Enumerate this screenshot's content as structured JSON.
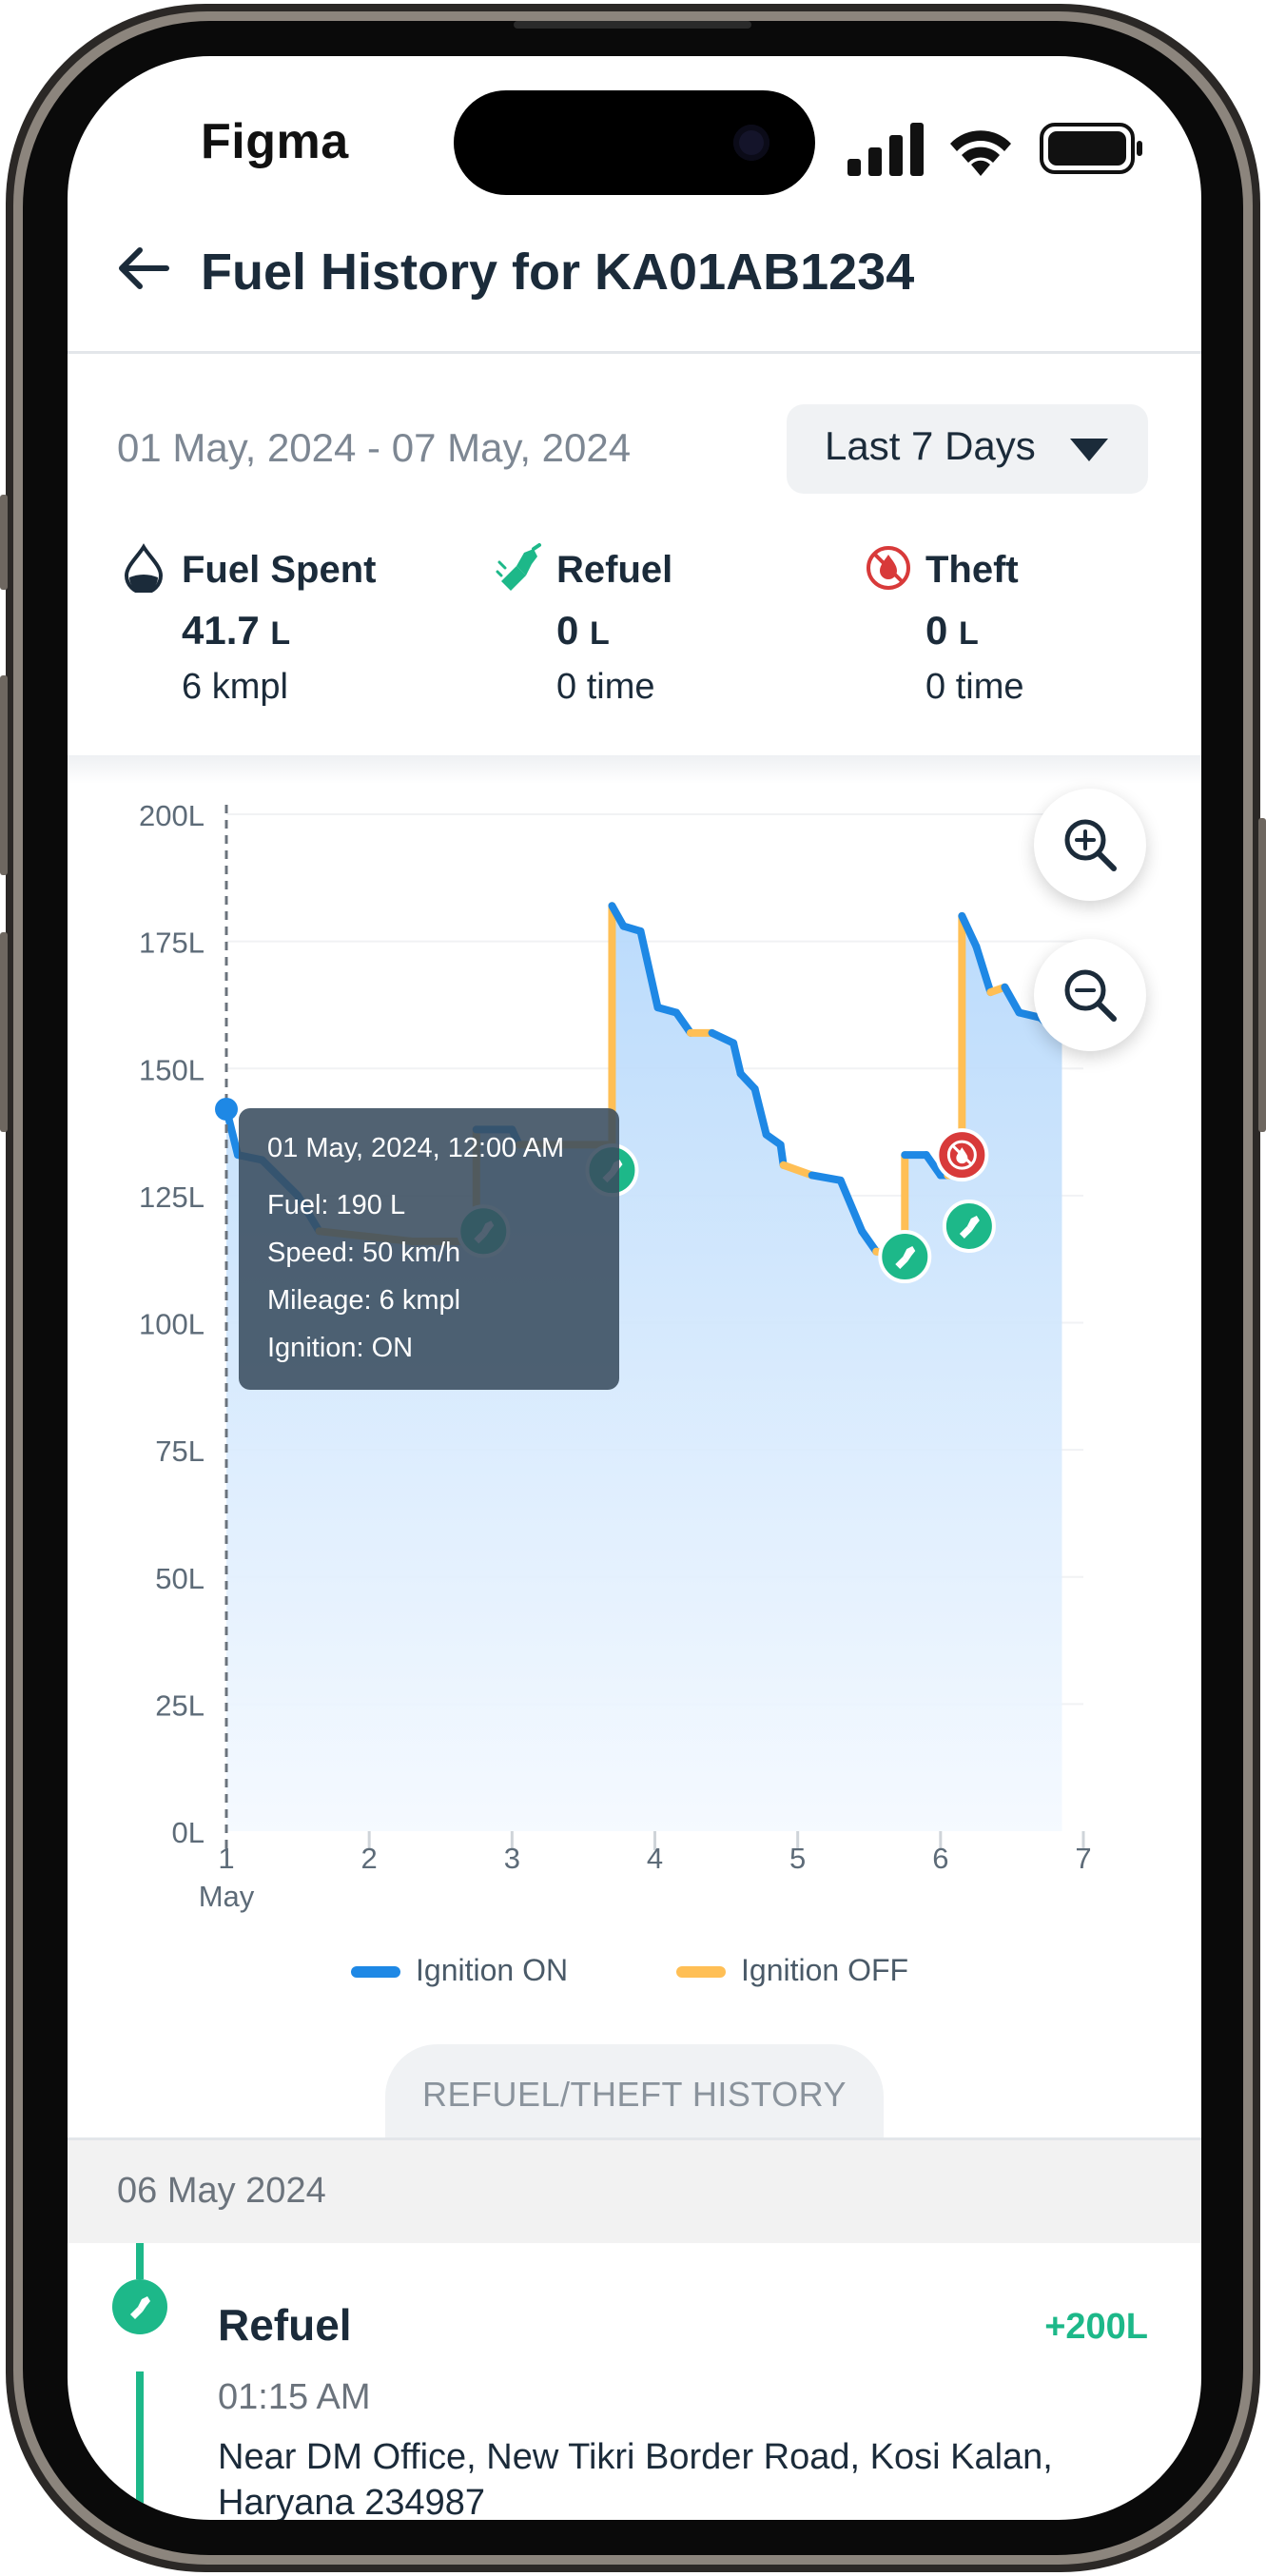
{
  "status_bar": {
    "app_name": "Figma"
  },
  "header": {
    "title": "Fuel History for KA01AB1234"
  },
  "filter": {
    "date_range": "01 May, 2024 - 07 May, 2024",
    "period_label": "Last 7 Days"
  },
  "stats": [
    {
      "label": "Fuel Spent",
      "value": "41.7",
      "unit": "L",
      "sub": "6 kmpl",
      "icon": "fuel-drop-icon"
    },
    {
      "label": "Refuel",
      "value": "0",
      "unit": "L",
      "sub": "0 time",
      "icon": "fuel-pump-icon"
    },
    {
      "label": "Theft",
      "value": "0",
      "unit": "L",
      "sub": "0 time",
      "icon": "theft-icon"
    }
  ],
  "colors": {
    "ignition_on": "#1E88E5",
    "ignition_off": "#FFBF55",
    "refuel": "#1DB889",
    "theft": "#D83A3A",
    "area_top": "#B3D7FB"
  },
  "chart_data": {
    "type": "line",
    "y_ticks": [
      "200L",
      "175L",
      "150L",
      "125L",
      "100L",
      "75L",
      "50L",
      "25L",
      "0L"
    ],
    "x_ticks": [
      "1",
      "2",
      "3",
      "4",
      "5",
      "6",
      "7"
    ],
    "x_sublabel": "May",
    "ylim": [
      0,
      200
    ],
    "xlim": [
      1,
      7
    ],
    "legend": [
      "Ignition ON",
      "Ignition OFF"
    ],
    "points": [
      [
        1.0,
        142,
        "on"
      ],
      [
        1.08,
        133,
        "on"
      ],
      [
        1.25,
        132,
        "on"
      ],
      [
        1.5,
        125,
        "on"
      ],
      [
        1.65,
        118,
        "on"
      ],
      [
        2.3,
        116,
        "off"
      ],
      [
        2.6,
        116,
        "off"
      ],
      [
        2.75,
        116,
        "off"
      ],
      [
        2.75,
        138,
        "off"
      ],
      [
        3.0,
        138,
        "on"
      ],
      [
        3.05,
        135,
        "on"
      ],
      [
        3.7,
        135,
        "off"
      ],
      [
        3.7,
        182,
        "off"
      ],
      [
        3.78,
        178,
        "on"
      ],
      [
        3.9,
        177,
        "on"
      ],
      [
        4.02,
        162,
        "on"
      ],
      [
        4.15,
        161,
        "on"
      ],
      [
        4.25,
        157,
        "on"
      ],
      [
        4.4,
        157,
        "off"
      ],
      [
        4.55,
        155,
        "on"
      ],
      [
        4.6,
        149,
        "on"
      ],
      [
        4.7,
        146,
        "on"
      ],
      [
        4.78,
        137,
        "on"
      ],
      [
        4.88,
        135,
        "on"
      ],
      [
        4.9,
        131,
        "on"
      ],
      [
        5.1,
        129,
        "off"
      ],
      [
        5.3,
        128,
        "on"
      ],
      [
        5.45,
        118,
        "on"
      ],
      [
        5.55,
        114,
        "on"
      ],
      [
        5.75,
        113,
        "off"
      ],
      [
        5.75,
        133,
        "off"
      ],
      [
        5.9,
        133,
        "on"
      ],
      [
        6.0,
        129,
        "on"
      ],
      [
        6.05,
        129,
        "on"
      ],
      [
        6.15,
        129,
        "off"
      ],
      [
        6.15,
        180,
        "off"
      ],
      [
        6.25,
        174,
        "on"
      ],
      [
        6.35,
        165,
        "on"
      ],
      [
        6.45,
        166,
        "off"
      ],
      [
        6.55,
        161,
        "on"
      ],
      [
        6.7,
        160,
        "on"
      ],
      [
        6.85,
        156,
        "on"
      ]
    ],
    "markers": [
      {
        "type": "refuel",
        "x": 2.8,
        "y": 118
      },
      {
        "type": "refuel",
        "x": 3.7,
        "y": 130
      },
      {
        "type": "refuel",
        "x": 5.75,
        "y": 113
      },
      {
        "type": "refuel",
        "x": 6.2,
        "y": 119
      },
      {
        "type": "theft",
        "x": 6.15,
        "y": 133
      }
    ],
    "cursor": {
      "x": 1.0,
      "y": 142
    },
    "tooltip": {
      "time": "01 May, 2024, 12:00 AM",
      "fuel": "Fuel: 190 L",
      "speed": "Speed: 50 km/h",
      "mileage": "Mileage: 6 kmpl",
      "ignition": "Ignition: ON"
    }
  },
  "history": {
    "tab_label": "REFUEL/THEFT HISTORY",
    "day_label": "06 May 2024",
    "event": {
      "title": "Refuel",
      "amount": "+200L",
      "time": "01:15 AM",
      "address": "Near DM Office, New Tikri Border Road, Kosi Kalan, Haryana 234987"
    }
  }
}
